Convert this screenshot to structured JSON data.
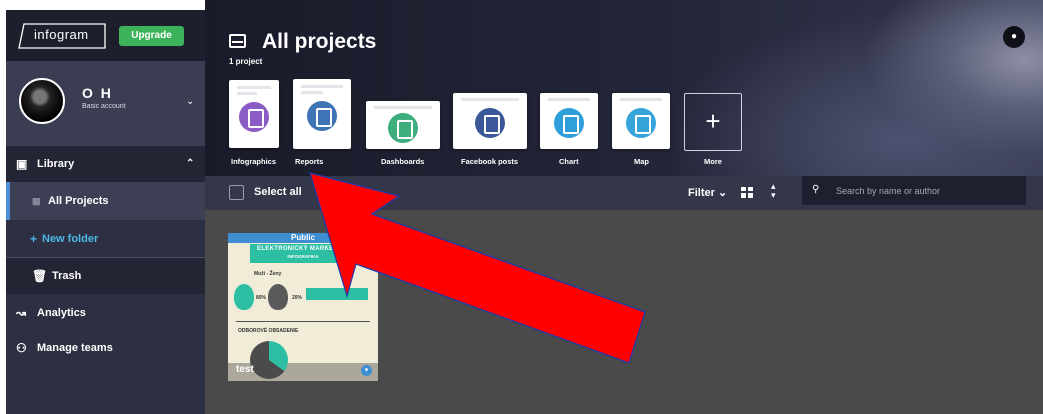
{
  "sidebar": {
    "logo": "infogram",
    "upgrade_label": "Upgrade",
    "account": {
      "name": "O H",
      "plan": "Basic account"
    },
    "library_label": "Library",
    "all_projects_label": "All Projects",
    "new_folder_label": "New folder",
    "trash_label": "Trash",
    "analytics_label": "Analytics",
    "manage_teams_label": "Manage teams"
  },
  "header": {
    "title": "All projects",
    "count": "1 project",
    "templates": [
      {
        "label": "Infographics",
        "color": "#8b5cc4"
      },
      {
        "label": "Reports",
        "color": "#3e73b6"
      },
      {
        "label": "Dashboards",
        "color": "#3fae7e"
      },
      {
        "label": "Facebook posts",
        "color": "#3b5998"
      },
      {
        "label": "Chart",
        "color": "#2e9fd8"
      },
      {
        "label": "Map",
        "color": "#36a3d9"
      },
      {
        "label": "More",
        "color": "#ffffff"
      }
    ]
  },
  "toolbar": {
    "select_all": "Select all",
    "filter": "Filter",
    "search_placeholder": "Search by name or author"
  },
  "projects": [
    {
      "name": "test",
      "badge": "Public",
      "thumb_title": "ELEKTRONICKÝ MARKETING",
      "thumb_subtitle": "INFOGRAFIKA",
      "thumb_text_1": "Muži - Ženy",
      "thumb_text_2": "80%",
      "thumb_text_3": "20%",
      "thumb_heading": "ODBOROVÉ OBSADENIE"
    }
  ],
  "colors": {
    "accent_blue": "#4f8ed6",
    "upgrade_green": "#3cb35a",
    "annotation_arrow": "#ff0000"
  }
}
